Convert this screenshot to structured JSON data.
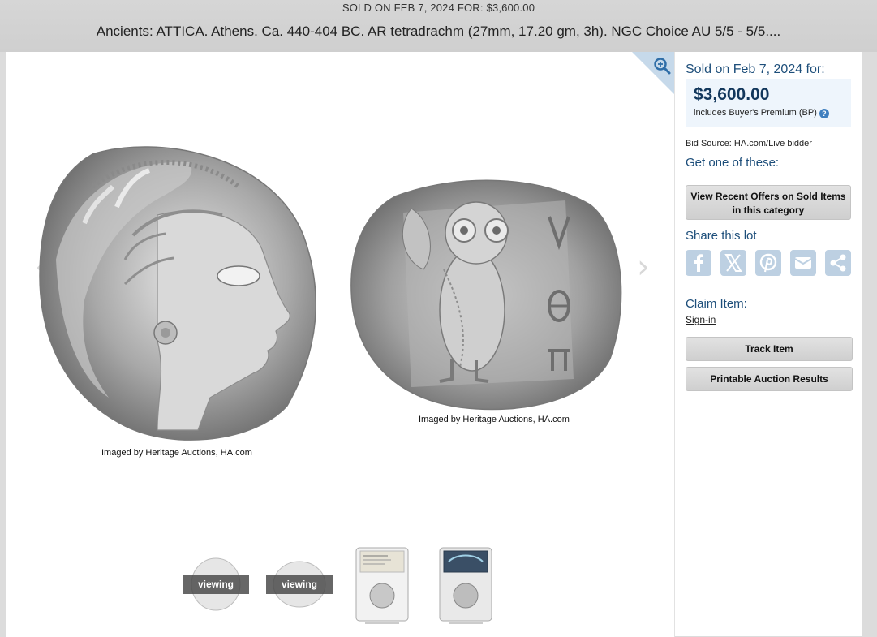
{
  "header": {
    "sold_line": "SOLD ON FEB 7, 2024 FOR: $3,600.00",
    "title": "Ancients: ATTICA. Athens. Ca. 440-404 BC. AR tetradrachm (27mm, 17.20 gm, 3h). NGC Choice AU 5/5 - 5/5...."
  },
  "gallery": {
    "zoom_icon": "zoom-in-icon",
    "prev_arrow": "‹",
    "next_arrow": "›",
    "obverse_caption": "Imaged by Heritage Auctions, HA.com",
    "reverse_caption": "Imaged by Heritage Auctions, HA.com"
  },
  "thumbnails": [
    {
      "badge": "viewing"
    },
    {
      "badge": "viewing"
    },
    {
      "badge": ""
    },
    {
      "badge": ""
    }
  ],
  "sidebar": {
    "sold_heading": "Sold on Feb 7, 2024 for:",
    "price": "$3,600.00",
    "bp_text": "includes Buyer's Premium (BP)",
    "help_glyph": "?",
    "bid_source": "Bid Source: HA.com/Live bidder",
    "get_one": "Get one of these:",
    "offers_button": "View Recent Offers on Sold Items in this category",
    "share_heading": "Share this lot",
    "share_icons": [
      "facebook-icon",
      "x-icon",
      "pinterest-icon",
      "email-icon",
      "share-icon"
    ],
    "claim_heading": "Claim Item:",
    "sign_in": "Sign-in",
    "track_button": "Track Item",
    "print_button": "Printable Auction Results"
  },
  "colors": {
    "accent_text": "#1d4e7a",
    "price_box": "#eef5fc",
    "share_button": "#bdd0e2"
  }
}
